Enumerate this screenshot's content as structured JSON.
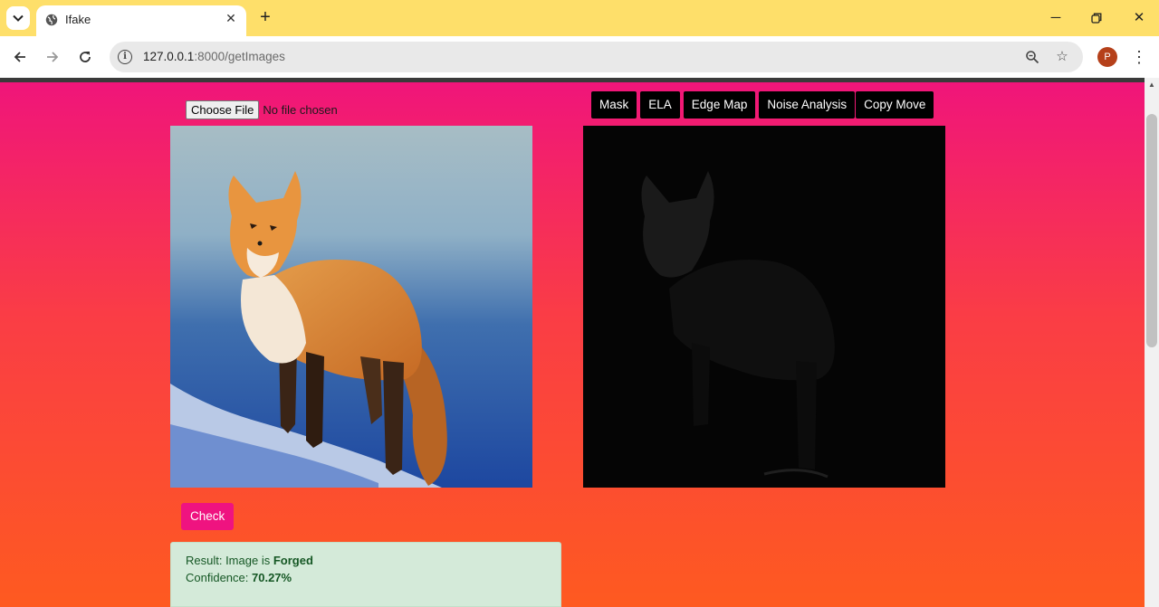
{
  "browser": {
    "tab_title": "Ifake",
    "url_host": "127.0.0.1",
    "url_rest": ":8000/getImages",
    "profile_initial": "P"
  },
  "upload": {
    "choose_label": "Choose File",
    "status": "No file chosen"
  },
  "tools": {
    "mask": "Mask",
    "ela": "ELA",
    "edge_map": "Edge Map",
    "noise_analysis": "Noise Analysis",
    "copy_move": "Copy Move"
  },
  "check_label": "Check",
  "result": {
    "prefix": "Result: Image is ",
    "verdict": "Forged",
    "confidence_label": "Confidence: ",
    "confidence_value": "70.27%"
  },
  "colors": {
    "tab_bar": "#fedf6a",
    "page_top": "#f0157a",
    "page_bottom": "#fe5a20",
    "check_button": "#ef1380",
    "result_bg": "#d4ead9",
    "result_text": "#155724"
  },
  "icons": [
    "tab-search-icon",
    "globe-icon",
    "close-icon",
    "plus-icon",
    "minimize-icon",
    "restore-icon",
    "back-arrow-icon",
    "forward-arrow-icon",
    "reload-icon",
    "info-icon",
    "zoom-icon",
    "star-icon",
    "more-icon"
  ]
}
